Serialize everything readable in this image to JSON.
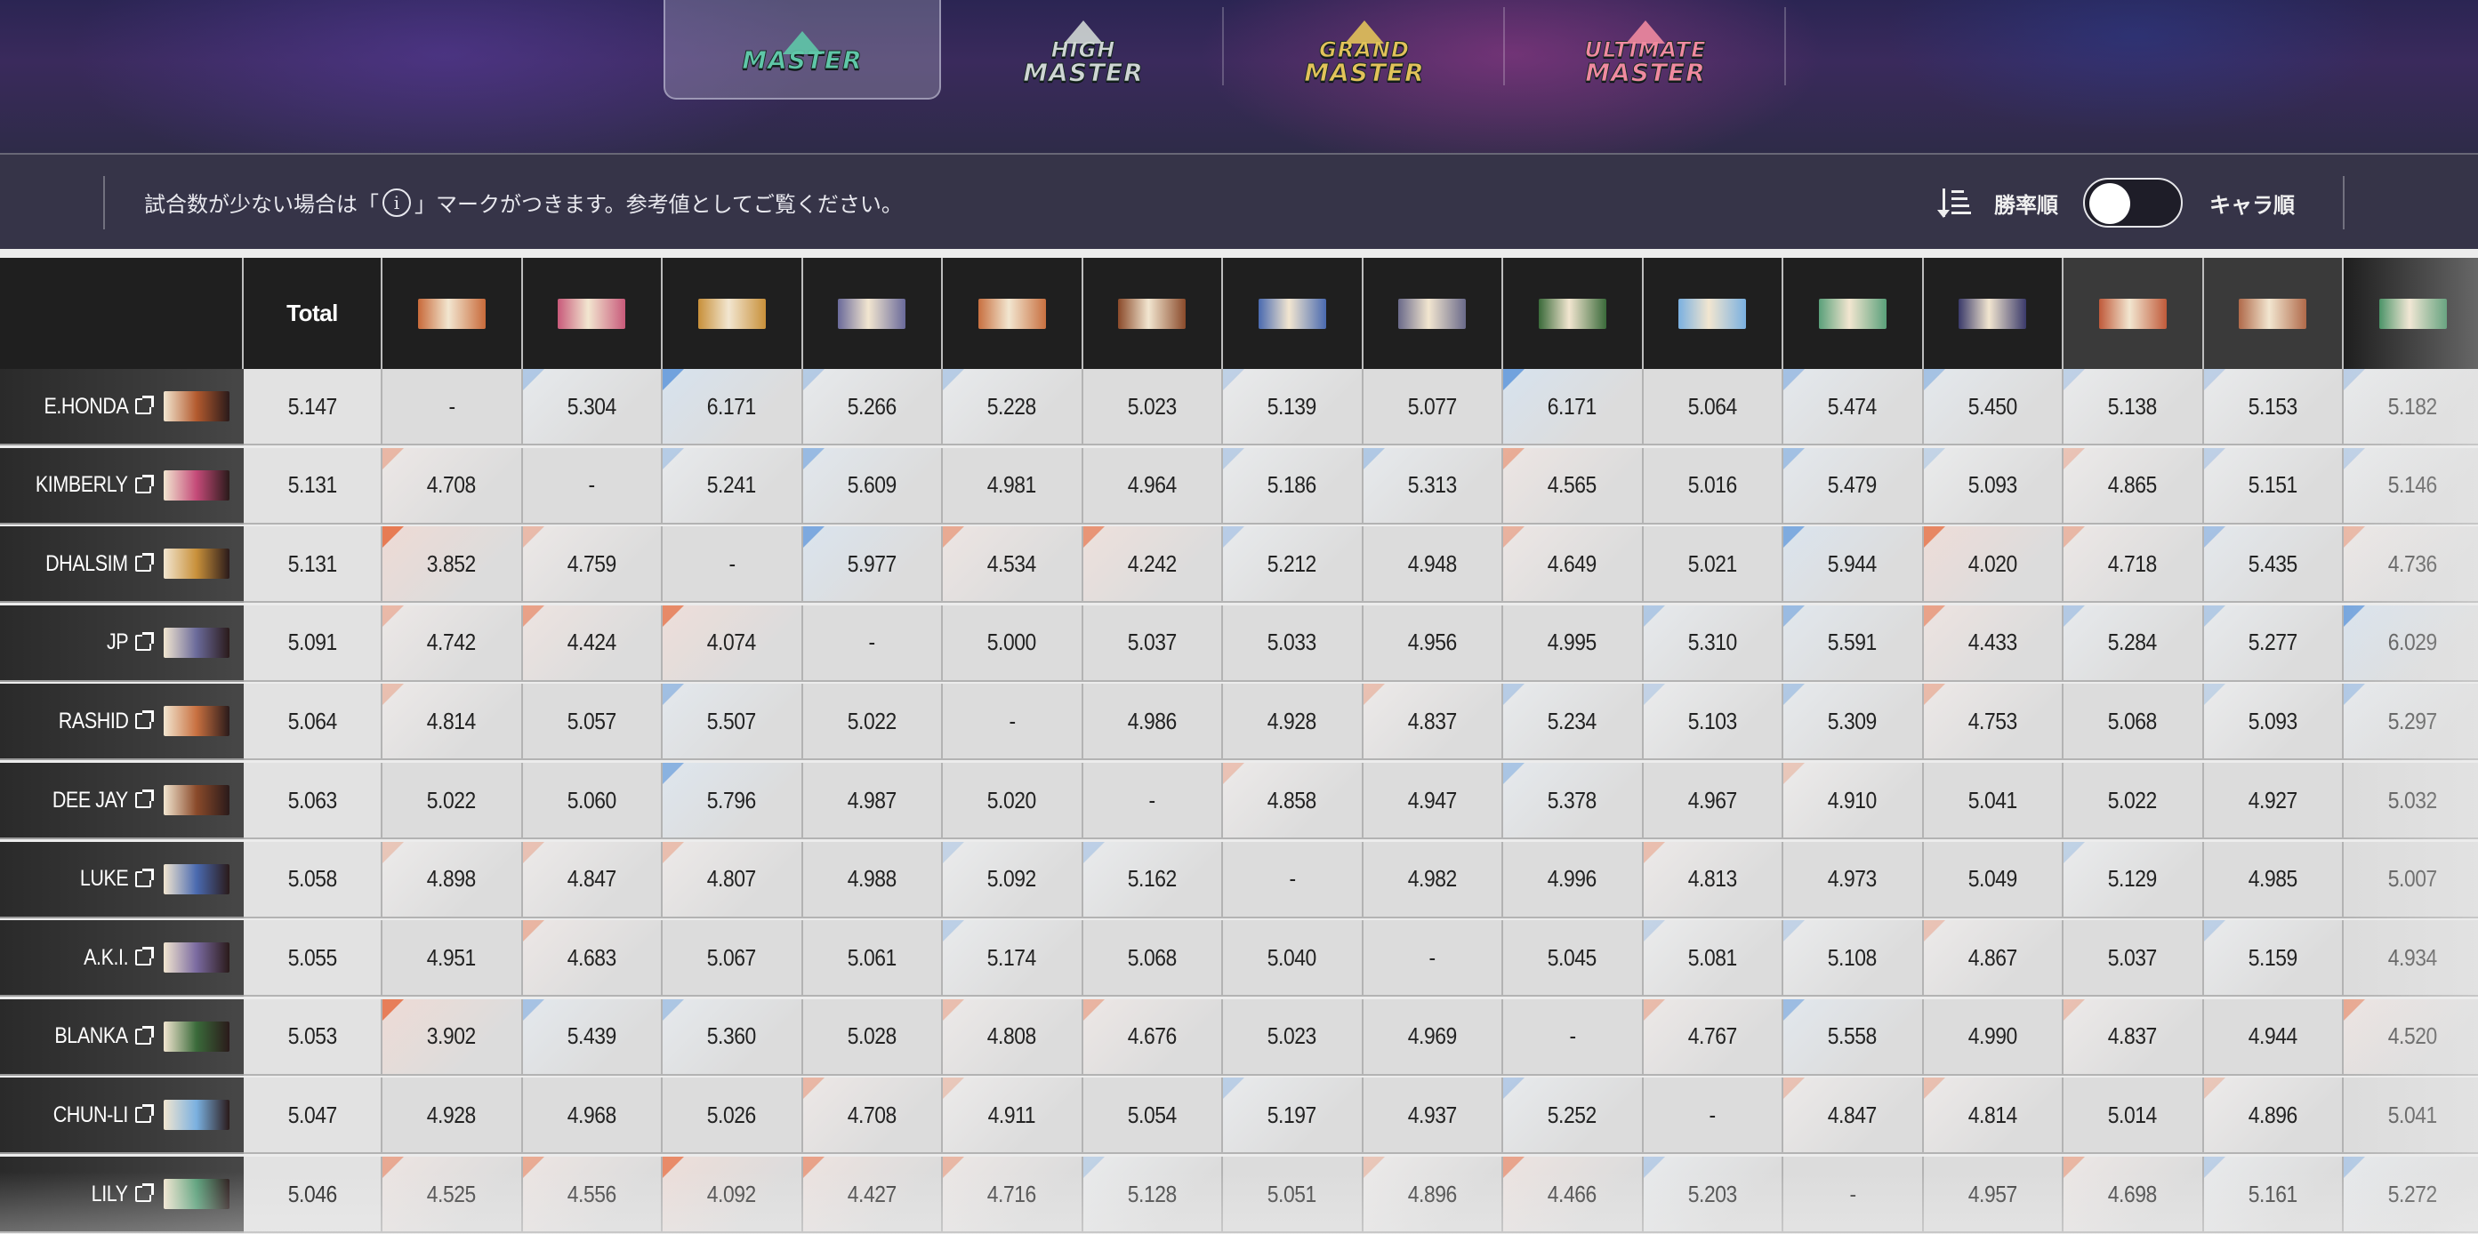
{
  "ranks": [
    {
      "lines": [
        "MASTER"
      ],
      "color": "#5fc7a8",
      "active": true,
      "icon": "master-rank-icon"
    },
    {
      "lines": [
        "HIGH",
        "MASTER"
      ],
      "color": "#cfd6d4",
      "active": false,
      "icon": "high-master-rank-icon"
    },
    {
      "lines": [
        "GRAND",
        "MASTER"
      ],
      "color": "#e2c25a",
      "active": false,
      "icon": "grand-master-rank-icon"
    },
    {
      "lines": [
        "ULTIMATE",
        "MASTER"
      ],
      "color": "#f08aa0",
      "active": false,
      "icon": "ultimate-master-rank-icon"
    }
  ],
  "notice": {
    "before": "試合数が少ない場合は「",
    "icon": "i",
    "after": "」マークがつきます。参考値としてご覧ください。"
  },
  "sort": {
    "winrate_label": "勝率順",
    "character_label": "キャラ順",
    "toggle_on": false
  },
  "table": {
    "total_label": "Total",
    "column_icon_colors": [
      "#c86a3a",
      "#c85a7a",
      "#c8903a",
      "#6a6a9a",
      "#c87040",
      "#8a4a2a",
      "#4a6ab0",
      "#6a6a8a",
      "#3a6a3a",
      "#7ab0e0",
      "#5aa07a",
      "#3a3a6a",
      "#c05a3a",
      "#b06a4a",
      "#3a8a5a"
    ],
    "rows": [
      {
        "name": "E.HONDA",
        "thumb": "#b35a2e",
        "total": "5.147",
        "values": [
          "-",
          "5.304",
          "6.171",
          "5.266",
          "5.228",
          "5.023",
          "5.139",
          "5.077",
          "6.171",
          "5.064",
          "5.474",
          "5.450",
          "5.138",
          "5.153",
          "5.182"
        ]
      },
      {
        "name": "KIMBERLY",
        "thumb": "#c44a78",
        "total": "5.131",
        "values": [
          "4.708",
          "-",
          "5.241",
          "5.609",
          "4.981",
          "4.964",
          "5.186",
          "5.313",
          "4.565",
          "5.016",
          "5.479",
          "5.093",
          "4.865",
          "5.151",
          "5.146"
        ]
      },
      {
        "name": "DHALSIM",
        "thumb": "#c8903a",
        "total": "5.131",
        "values": [
          "3.852",
          "4.759",
          "-",
          "5.977",
          "4.534",
          "4.242",
          "5.212",
          "4.948",
          "4.649",
          "5.021",
          "5.944",
          "4.020",
          "4.718",
          "5.435",
          "4.736"
        ]
      },
      {
        "name": "JP",
        "thumb": "#6a6a9a",
        "total": "5.091",
        "values": [
          "4.742",
          "4.424",
          "4.074",
          "-",
          "5.000",
          "5.037",
          "5.033",
          "4.956",
          "4.995",
          "5.310",
          "5.591",
          "4.433",
          "5.284",
          "5.277",
          "6.029"
        ]
      },
      {
        "name": "RASHID",
        "thumb": "#c87040",
        "total": "5.064",
        "values": [
          "4.814",
          "5.057",
          "5.507",
          "5.022",
          "-",
          "4.986",
          "4.928",
          "4.837",
          "5.234",
          "5.103",
          "5.309",
          "4.753",
          "5.068",
          "5.093",
          "5.297"
        ]
      },
      {
        "name": "DEE JAY",
        "thumb": "#8a4a2a",
        "total": "5.063",
        "values": [
          "5.022",
          "5.060",
          "5.796",
          "4.987",
          "5.020",
          "-",
          "4.858",
          "4.947",
          "5.378",
          "4.967",
          "4.910",
          "5.041",
          "5.022",
          "4.927",
          "5.032"
        ]
      },
      {
        "name": "LUKE",
        "thumb": "#4a6ab0",
        "total": "5.058",
        "values": [
          "4.898",
          "4.847",
          "4.807",
          "4.988",
          "5.092",
          "5.162",
          "-",
          "4.982",
          "4.996",
          "4.813",
          "4.973",
          "5.049",
          "5.129",
          "4.985",
          "5.007"
        ]
      },
      {
        "name": "A.K.I.",
        "thumb": "#7a6aa0",
        "total": "5.055",
        "values": [
          "4.951",
          "4.683",
          "5.067",
          "5.061",
          "5.174",
          "5.068",
          "5.040",
          "-",
          "5.045",
          "5.081",
          "5.108",
          "4.867",
          "5.037",
          "5.159",
          "4.934"
        ]
      },
      {
        "name": "BLANKA",
        "thumb": "#3a6a3a",
        "total": "5.053",
        "values": [
          "3.902",
          "5.439",
          "5.360",
          "5.028",
          "4.808",
          "4.676",
          "5.023",
          "4.969",
          "-",
          "4.767",
          "5.558",
          "4.990",
          "4.837",
          "4.944",
          "4.520"
        ]
      },
      {
        "name": "CHUN-LI",
        "thumb": "#7ab0e0",
        "total": "5.047",
        "values": [
          "4.928",
          "4.968",
          "5.026",
          "4.708",
          "4.911",
          "5.054",
          "5.197",
          "4.937",
          "5.252",
          "-",
          "4.847",
          "4.814",
          "5.014",
          "4.896",
          "5.041"
        ]
      },
      {
        "name": "LILY",
        "thumb": "#5aa07a",
        "total": "5.046",
        "values": [
          "4.525",
          "4.556",
          "4.092",
          "4.427",
          "4.716",
          "5.128",
          "5.051",
          "4.896",
          "4.466",
          "5.203",
          "-",
          "4.957",
          "4.698",
          "5.161",
          "5.272"
        ]
      }
    ]
  }
}
